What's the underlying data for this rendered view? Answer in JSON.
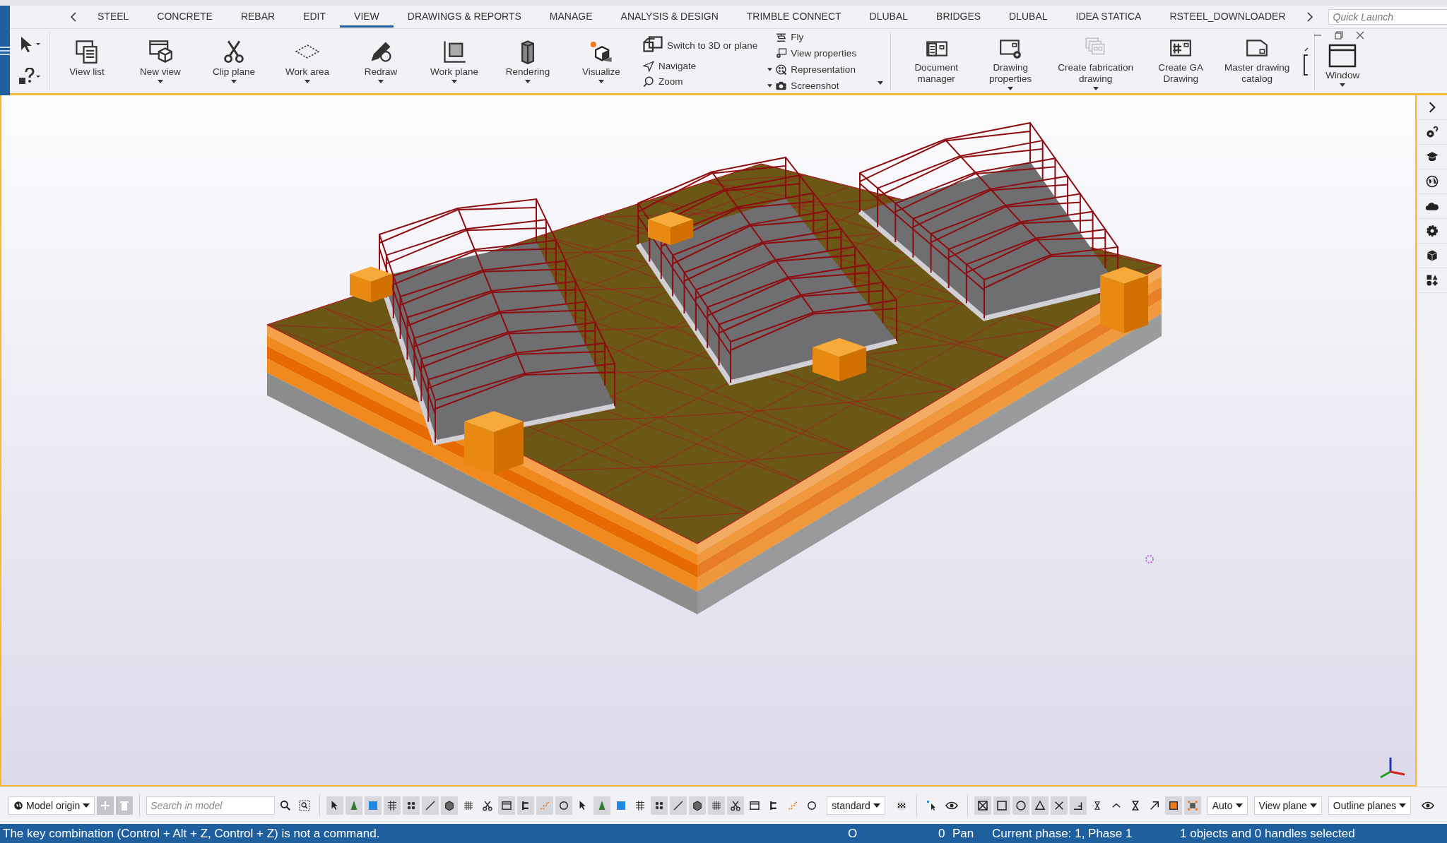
{
  "tabs": [
    {
      "label": "STEEL",
      "selected": false
    },
    {
      "label": "CONCRETE",
      "selected": false
    },
    {
      "label": "REBAR",
      "selected": false
    },
    {
      "label": "EDIT",
      "selected": false
    },
    {
      "label": "VIEW",
      "selected": true
    },
    {
      "label": "DRAWINGS & REPORTS",
      "selected": false
    },
    {
      "label": "MANAGE",
      "selected": false
    },
    {
      "label": "ANALYSIS & DESIGN",
      "selected": false
    },
    {
      "label": "TRIMBLE CONNECT",
      "selected": false
    },
    {
      "label": "DLUBAL",
      "selected": false
    },
    {
      "label": "BRIDGES",
      "selected": false
    },
    {
      "label": "DLUBAL",
      "selected": false
    },
    {
      "label": "IDEA STATICA",
      "selected": false
    },
    {
      "label": "RSTEEL_DOWNLOADER",
      "selected": false
    }
  ],
  "quick_launch": {
    "placeholder": "Quick Launch"
  },
  "ribbon": {
    "view_buttons": [
      {
        "label": "View list",
        "dropdown": false
      },
      {
        "label": "New view",
        "dropdown": true
      },
      {
        "label": "Clip plane",
        "dropdown": true
      },
      {
        "label": "Work area",
        "dropdown": true
      },
      {
        "label": "Redraw",
        "dropdown": true
      },
      {
        "label": "Work plane",
        "dropdown": true
      },
      {
        "label": "Rendering",
        "dropdown": true
      },
      {
        "label": "Visualize",
        "dropdown": true
      }
    ],
    "navigation_items": [
      {
        "label": "Switch to 3D or plane"
      },
      {
        "label": "Navigate"
      },
      {
        "label": "Zoom"
      }
    ],
    "view_items": [
      {
        "label": "Fly",
        "dropdown": false
      },
      {
        "label": "View properties",
        "dropdown": false
      },
      {
        "label": "Representation",
        "dropdown": true
      },
      {
        "label": "Screenshot",
        "dropdown": true
      }
    ],
    "drawing_buttons": [
      {
        "label": "Document manager",
        "dropdown": false,
        "disabled": false
      },
      {
        "label": "Drawing properties",
        "dropdown": true,
        "disabled": false
      },
      {
        "label": "Create fabrication drawing",
        "dropdown": true,
        "disabled": true
      },
      {
        "label": "Create GA Drawing",
        "dropdown": false,
        "disabled": false
      },
      {
        "label": "Master drawing catalog",
        "dropdown": false,
        "disabled": false
      }
    ],
    "window_button": {
      "label": "Window",
      "dropdown": true
    }
  },
  "bottom_toolbar": {
    "model_origin": "Model origin",
    "search": {
      "placeholder": "Search in model"
    },
    "select_tools": [
      {
        "on": true
      },
      {
        "on": true
      },
      {
        "on": true
      },
      {
        "on": true
      },
      {
        "on": true
      },
      {
        "on": true
      },
      {
        "on": true
      },
      {
        "on": false
      },
      {
        "on": false
      },
      {
        "on": true
      },
      {
        "on": true
      },
      {
        "on": true
      },
      {
        "on": true
      },
      {
        "on": false
      },
      {
        "on": true
      },
      {
        "on": false
      },
      {
        "on": false
      },
      {
        "on": true
      },
      {
        "on": true
      },
      {
        "on": true
      },
      {
        "on": true
      },
      {
        "on": true
      },
      {
        "on": false
      },
      {
        "on": false
      },
      {
        "on": false
      },
      {
        "on": false
      }
    ],
    "render_mode": "standard",
    "snap_tools": [
      {
        "on": true
      },
      {
        "on": true
      },
      {
        "on": true
      },
      {
        "on": true
      },
      {
        "on": true
      },
      {
        "on": true
      },
      {
        "on": false
      },
      {
        "on": false
      },
      {
        "on": false
      },
      {
        "on": false
      },
      {
        "on": true
      },
      {
        "on": true
      }
    ],
    "dropdowns": [
      "Auto",
      "View plane",
      "Outline planes"
    ]
  },
  "status_bar": {
    "message": "The key combination (Control + Alt + Z, Control + Z) is not a command.",
    "marker": "O",
    "count": "0",
    "mode": "Pan",
    "phase": "Current phase: 1, Phase 1",
    "selection": "1 objects and 0 handles selected"
  }
}
